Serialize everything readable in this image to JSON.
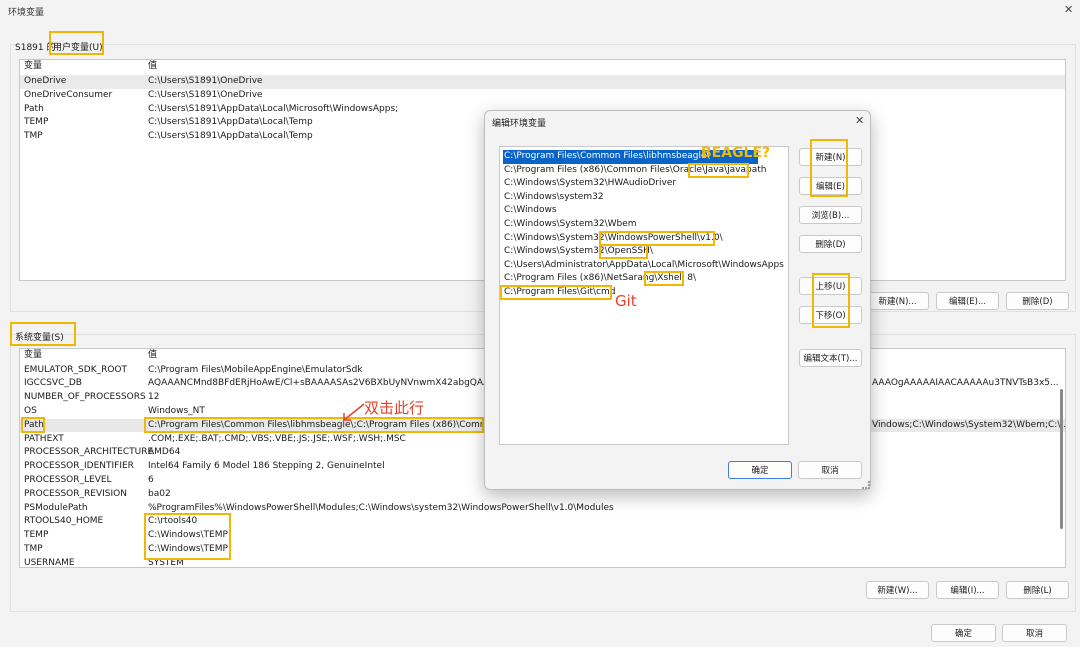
{
  "window": {
    "title": "环境变量",
    "close": "✕"
  },
  "user_vars": {
    "group_prefix": "S1891 的",
    "group_label": "用户变量(U)",
    "headers": [
      "变量",
      "值"
    ],
    "rows": [
      {
        "name": "OneDrive",
        "value": "C:\\Users\\S1891\\OneDrive"
      },
      {
        "name": "OneDriveConsumer",
        "value": "C:\\Users\\S1891\\OneDrive"
      },
      {
        "name": "Path",
        "value": "C:\\Users\\S1891\\AppData\\Local\\Microsoft\\WindowsApps;"
      },
      {
        "name": "TEMP",
        "value": "C:\\Users\\S1891\\AppData\\Local\\Temp"
      },
      {
        "name": "TMP",
        "value": "C:\\Users\\S1891\\AppData\\Local\\Temp"
      }
    ],
    "buttons": {
      "new": "新建(N)...",
      "edit": "编辑(E)...",
      "delete": "删除(D)"
    }
  },
  "system_vars": {
    "group_label": "系统变量(S)",
    "headers": [
      "变量",
      "值"
    ],
    "rows": [
      {
        "name": "EMULATOR_SDK_ROOT",
        "value": "C:\\Program Files\\MobileAppEngine\\EmulatorSdk",
        "value_right": ""
      },
      {
        "name": "IGCCSVC_DB",
        "value": "AQAAANCMnd8BFdERjHoAwE/Cl+sBAAAASAs2V6BXbUyNVnwmX42abgQAAAA",
        "value_right": "AAAOgAAAAAIAACAAAAAu3TNVTsB3x5..."
      },
      {
        "name": "NUMBER_OF_PROCESSORS",
        "value": "12",
        "value_right": ""
      },
      {
        "name": "OS",
        "value": "Windows_NT",
        "value_right": ""
      },
      {
        "name": "Path",
        "value": "C:\\Program Files\\Common Files\\libhmsbeagle\\;C:\\Program Files (x86)\\Common F",
        "value_right": "Vindows;C:\\Windows\\System32\\Wbem;C:\\..."
      },
      {
        "name": "PATHEXT",
        "value": ".COM;.EXE;.BAT;.CMD;.VBS;.VBE;.JS;.JSE;.WSF;.WSH;.MSC",
        "value_right": ""
      },
      {
        "name": "PROCESSOR_ARCHITECTURE",
        "value": "AMD64",
        "value_right": ""
      },
      {
        "name": "PROCESSOR_IDENTIFIER",
        "value": "Intel64 Family 6 Model 186 Stepping 2, GenuineIntel",
        "value_right": ""
      },
      {
        "name": "PROCESSOR_LEVEL",
        "value": "6",
        "value_right": ""
      },
      {
        "name": "PROCESSOR_REVISION",
        "value": "ba02",
        "value_right": ""
      },
      {
        "name": "PSModulePath",
        "value": "%ProgramFiles%\\WindowsPowerShell\\Modules;C:\\Windows\\system32\\WindowsPowerShell\\v1.0\\Modules",
        "value_right": ""
      },
      {
        "name": "RTOOLS40_HOME",
        "value": "C:\\rtools40",
        "value_right": ""
      },
      {
        "name": "TEMP",
        "value": "C:\\Windows\\TEMP",
        "value_right": ""
      },
      {
        "name": "TMP",
        "value": "C:\\Windows\\TEMP",
        "value_right": ""
      },
      {
        "name": "USERNAME",
        "value": "SYSTEM",
        "value_right": ""
      }
    ],
    "buttons": {
      "new": "新建(W)...",
      "edit": "编辑(I)...",
      "delete": "删除(L)"
    }
  },
  "footer": {
    "ok": "确定",
    "cancel": "取消"
  },
  "dialog": {
    "title": "编辑环境变量",
    "close": "✕",
    "entries": [
      "C:\\Program Files\\Common Files\\libhmsbeagle\\",
      "C:\\Program Files (x86)\\Common Files\\Oracle\\Java\\javapath",
      "C:\\Windows\\System32\\HWAudioDriver",
      "C:\\Windows\\system32",
      "C:\\Windows",
      "C:\\Windows\\System32\\Wbem",
      "C:\\Windows\\System32\\WindowsPowerShell\\v1.0\\",
      "C:\\Windows\\System32\\OpenSSH\\",
      "C:\\Users\\Administrator\\AppData\\Local\\Microsoft\\WindowsApps",
      "C:\\Program Files (x86)\\NetSarang\\Xshell 8\\",
      "C:\\Program Files\\Git\\cmd"
    ],
    "buttons": {
      "new": "新建(N)",
      "edit": "编辑(E)",
      "browse": "浏览(B)...",
      "delete": "删除(D)",
      "up": "上移(U)",
      "down": "下移(O)",
      "edit_text": "编辑文本(T)...",
      "ok": "确定",
      "cancel": "取消"
    }
  },
  "annotations": {
    "beagle": "BEAGLE?",
    "git": "Git",
    "double_click": "双击此行"
  },
  "colors": {
    "highlight": "#f2b705",
    "annotation_red": "#e8402a",
    "annotation_yellow": "#f2b705",
    "selection": "#0a64c8"
  }
}
